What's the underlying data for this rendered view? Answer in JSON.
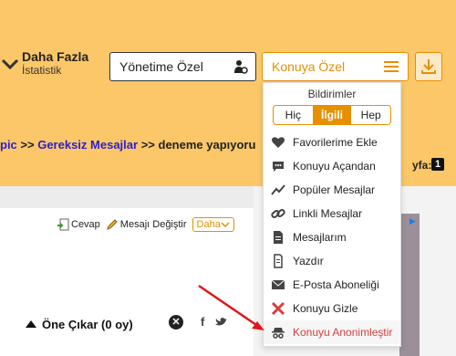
{
  "stats": {
    "title": "Daha Fazla",
    "subtitle": "İstatistik"
  },
  "header": {
    "management_label": "Yönetime Özel",
    "topic_label": "Konuya Özel"
  },
  "breadcrumb": {
    "prefix": "pic",
    "sep1": " >> ",
    "link": "Gereksiz Mesajlar",
    "sep2": " >> ",
    "current": "deneme yapıyoru"
  },
  "pagination": {
    "label": "yfa:",
    "page": "1"
  },
  "post_actions": {
    "reply": "Cevap",
    "edit": "Mesajı Değiştir",
    "more": "Daha"
  },
  "promote": {
    "label": "Öne Çıkar (0 oy)"
  },
  "social": {
    "facebook": "f"
  },
  "dropdown": {
    "title": "Bildirimler",
    "segments": [
      "Hiç",
      "İlgili",
      "Hep"
    ],
    "selected": "İlgili",
    "items": [
      {
        "label": "Favorilerime Ekle",
        "icon": "heart-icon"
      },
      {
        "label": "Konuyu Açandan",
        "icon": "speech-bubble-icon"
      },
      {
        "label": "Popüler Mesajlar",
        "icon": "trend-icon"
      },
      {
        "label": "Linkli Mesajlar",
        "icon": "link-icon"
      },
      {
        "label": "Mesajlarım",
        "icon": "document-icon"
      },
      {
        "label": "Yazdır",
        "icon": "print-icon"
      },
      {
        "label": "E-Posta Aboneliği",
        "icon": "envelope-icon"
      },
      {
        "label": "Konuyu Gizle",
        "icon": "red-x-icon"
      },
      {
        "label": "Konuyu Anonimleştir",
        "icon": "incognito-icon"
      }
    ]
  },
  "colors": {
    "accent": "#e88f00",
    "background": "#fbc768",
    "link": "#2b1fd1",
    "highlight": "#d93d3d"
  }
}
